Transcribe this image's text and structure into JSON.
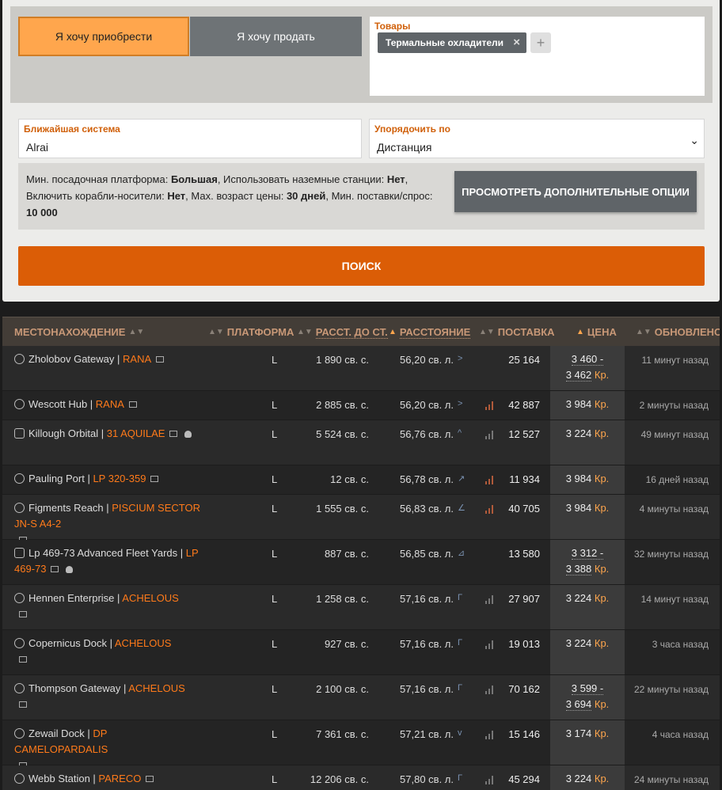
{
  "search": {
    "buy_label": "Я хочу приобрести",
    "sell_label": "Я хочу продать",
    "goods_label": "Товары",
    "goods_tag": "Термальные охладители",
    "tag_remove": "×",
    "add_symbol": "+",
    "system_label": "Ближайшая система",
    "system_value": "Alrai",
    "sort_label": "Упорядочить по",
    "sort_value": "Дистанция",
    "sort_chevron": "⌄",
    "options": {
      "p1": "Мин. посадочная платформа: ",
      "v1": "Большая",
      "p2": ", Использовать наземные станции: ",
      "v2": "Нет",
      "p3": ", Включить корабли-носители: ",
      "v3": "Нет",
      "p4": ", Мах. возраст цены: ",
      "v4": "30 дней",
      "p5": ", Мин. поставки/спрос: ",
      "v5": "10 000"
    },
    "more_options_label": "ПРОСМОТРЕТЬ ДОПОЛНИТЕЛЬНЫЕ ОПЦИИ",
    "search_label": "ПОИСК"
  },
  "table": {
    "headers": {
      "location": "МЕСТОНАХОЖДЕНИЕ",
      "platform": "ПЛАТФОРМА",
      "dist_star": "РАССТ. ДО СТ.",
      "distance": "РАССТОЯНИЕ",
      "supply": "ПОСТАВКА",
      "price": "ЦЕНА",
      "updated": "ОБНОВЛЕНО"
    },
    "sort_both": "▲▼",
    "sort_up": "▲",
    "currency": "Кр.",
    "rows": [
      {
        "station": "Zholobov Gateway",
        "system": "RANA",
        "platform": "L",
        "dist_star": "1 890 св. с.",
        "distance": "56,20 св. л.",
        "dir": ">",
        "supply": "25 164",
        "price1": "3 460 -",
        "price2": "3 462",
        "updated": "11 минут назад"
      },
      {
        "station": "Wescott Hub",
        "system": "RANA",
        "platform": "L",
        "dist_star": "2 885 св. с.",
        "distance": "56,20 св. л.",
        "dir": ">",
        "supply": "42 887",
        "price1": "3 984",
        "price2": "",
        "updated": "2 минуты назад"
      },
      {
        "station": "Killough Orbital",
        "system": "31 AQUILAE",
        "platform": "L",
        "dist_star": "5 524 св. с.",
        "distance": "56,76 св. л.",
        "dir": "^",
        "supply": "12 527",
        "price1": "3 224",
        "price2": "",
        "updated": "49 минут назад"
      },
      {
        "station": "Pauling Port",
        "system": "LP 320-359",
        "platform": "L",
        "dist_star": "12 св. с.",
        "distance": "56,78 св. л.",
        "dir": "↗",
        "supply": "11 934",
        "price1": "3 984",
        "price2": "",
        "updated": "16 дней назад"
      },
      {
        "station": "Figments Reach",
        "system": "PISCIUM SECTOR JN-S A4-2",
        "platform": "L",
        "dist_star": "1 555 св. с.",
        "distance": "56,83 св. л.",
        "dir": "∠",
        "supply": "40 705",
        "price1": "3 984",
        "price2": "",
        "updated": "4 минуты назад"
      },
      {
        "station": "Lp 469-73 Advanced Fleet Yards",
        "system": "LP 469-73",
        "platform": "L",
        "dist_star": "887 св. с.",
        "distance": "56,85 св. л.",
        "dir": "⊿",
        "supply": "13 580",
        "price1": "3 312 -",
        "price2": "3 388",
        "updated": "32 минуты назад"
      },
      {
        "station": "Hennen Enterprise",
        "system": "ACHELOUS",
        "platform": "L",
        "dist_star": "1 258 св. с.",
        "distance": "57,16 св. л.",
        "dir": "Γ",
        "supply": "27 907",
        "price1": "3 224",
        "price2": "",
        "updated": "14 минут назад"
      },
      {
        "station": "Copernicus Dock",
        "system": "ACHELOUS",
        "platform": "L",
        "dist_star": "927 св. с.",
        "distance": "57,16 св. л.",
        "dir": "Γ",
        "supply": "19 013",
        "price1": "3 224",
        "price2": "",
        "updated": "3 часа назад"
      },
      {
        "station": "Thompson Gateway",
        "system": "ACHELOUS",
        "platform": "L",
        "dist_star": "2 100 св. с.",
        "distance": "57,16 св. л.",
        "dir": "Γ",
        "supply": "70 162",
        "price1": "3 599 -",
        "price2": "3 694",
        "updated": "22 минуты назад"
      },
      {
        "station": "Zewail Dock",
        "system": "DP CAMELOPARDALIS",
        "platform": "L",
        "dist_star": "7 361 св. с.",
        "distance": "57,21 св. л.",
        "dir": "v",
        "supply": "15 146",
        "price1": "3 174",
        "price2": "",
        "updated": "4 часа назад"
      },
      {
        "station": "Webb Station",
        "system": "PARECO",
        "platform": "L",
        "dist_star": "12 206 св. с.",
        "distance": "57,80 св. л.",
        "dir": "Γ",
        "supply": "45 294",
        "price1": "3 224",
        "price2": "",
        "updated": "24 минуты назад"
      }
    ]
  }
}
